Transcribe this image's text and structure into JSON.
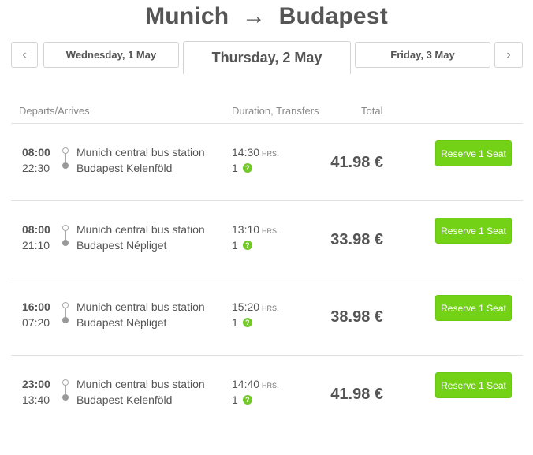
{
  "header": {
    "from": "Munich",
    "arrow": "→",
    "to": "Budapest"
  },
  "dates": {
    "prev_label": "‹",
    "next_label": "›",
    "tabs": [
      {
        "label": "Wednesday, 1 May",
        "active": false
      },
      {
        "label": "Thursday, 2 May",
        "active": true
      },
      {
        "label": "Friday, 3 May",
        "active": false
      }
    ]
  },
  "columns": {
    "departs": "Departs/Arrives",
    "duration": "Duration, Transfers",
    "total": "Total"
  },
  "trips": [
    {
      "depart": "08:00",
      "arrive": "22:30",
      "from": "Munich central bus station",
      "to": "Budapest Kelenföld",
      "duration": "14:30",
      "hrs": "HRS.",
      "transfers": "1",
      "price": "41.98 €",
      "button": "Reserve 1 Seat"
    },
    {
      "depart": "08:00",
      "arrive": "21:10",
      "from": "Munich central bus station",
      "to": "Budapest Népliget",
      "duration": "13:10",
      "hrs": "HRS.",
      "transfers": "1",
      "price": "33.98 €",
      "button": "Reserve 1 Seat"
    },
    {
      "depart": "16:00",
      "arrive": "07:20",
      "from": "Munich central bus station",
      "to": "Budapest Népliget",
      "duration": "15:20",
      "hrs": "HRS.",
      "transfers": "1",
      "price": "38.98 €",
      "button": "Reserve 1 Seat"
    },
    {
      "depart": "23:00",
      "arrive": "13:40",
      "from": "Munich central bus station",
      "to": "Budapest Kelenföld",
      "duration": "14:40",
      "hrs": "HRS.",
      "transfers": "1",
      "price": "41.98 €",
      "button": "Reserve 1 Seat"
    }
  ],
  "colors": {
    "accent": "#73d216",
    "text": "#555555"
  },
  "icons": {
    "transfer_info": "question-icon",
    "route": "route-line-icon"
  }
}
